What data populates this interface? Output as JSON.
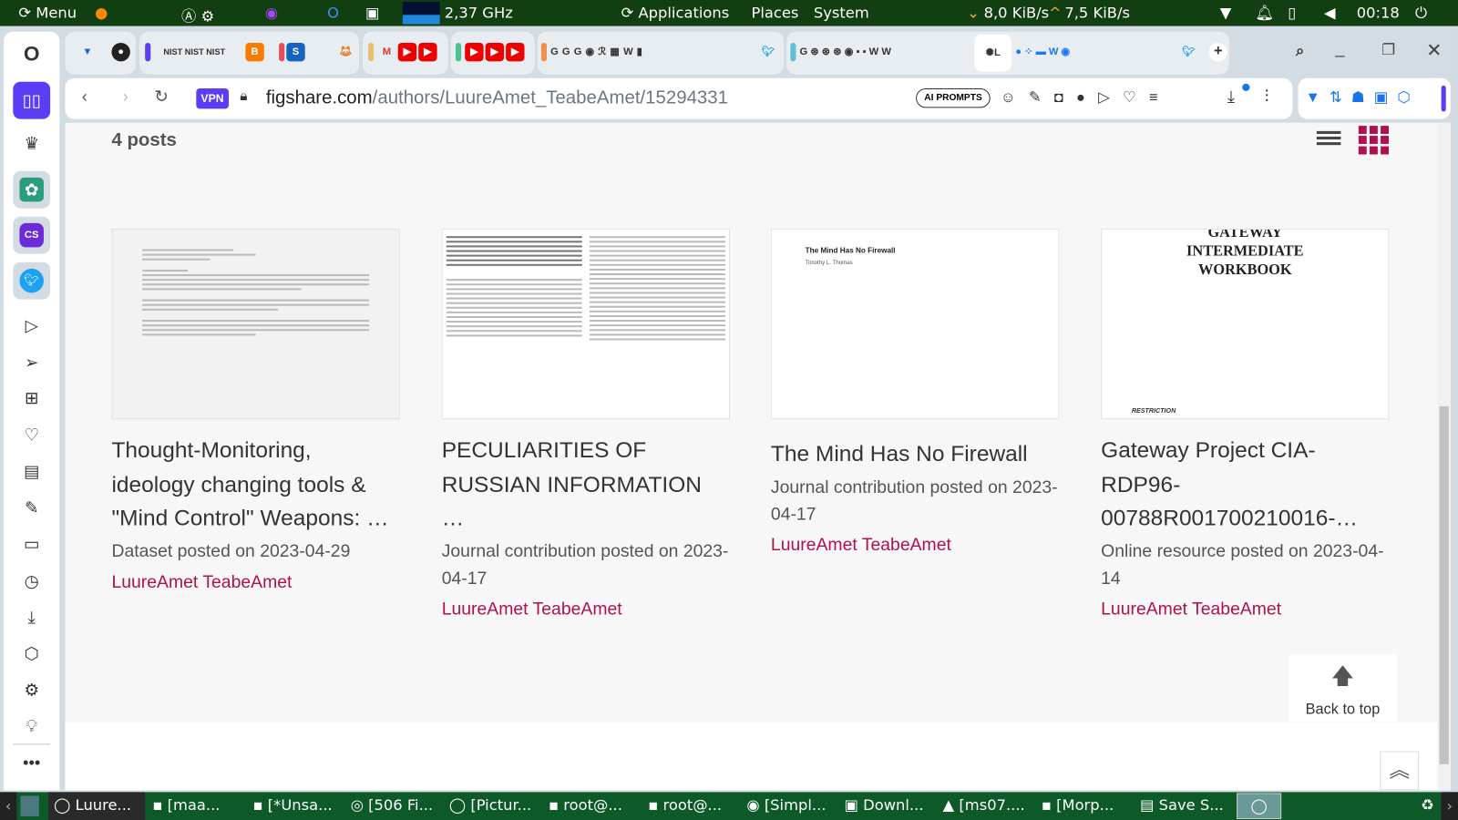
{
  "panel": {
    "menu": "Menu",
    "cpu": "2,37 GHz",
    "applications": "Applications",
    "places": "Places",
    "system": "System",
    "net_down": "8,0 KiB/s",
    "net_up": "7,5 KiB/s",
    "clock": "00:18"
  },
  "browser": {
    "url_host": "figshare.com",
    "url_path": "/authors/LuureAmet_TeabeAmet/15294331",
    "vpn": "VPN",
    "ai_prompts": "AI PROMPTS"
  },
  "page": {
    "posts_count": "4 posts",
    "back_to_top": "Back to top",
    "cards": [
      {
        "title": "Thought-Monitoring, ideology changing tools & \"Mind Control\" Weapons: …",
        "meta": "Dataset posted on 2023-04-29",
        "author": "LuureAmet TeabeAmet"
      },
      {
        "title": "PECULIARITIES OF RUSSIAN INFORMATION …",
        "meta": "Journal contribution posted on 2023-04-17",
        "author": "LuureAmet TeabeAmet"
      },
      {
        "title": "The Mind Has No Firewall",
        "meta": "Journal contribution posted on 2023-04-17",
        "author": "LuureAmet TeabeAmet",
        "thumb_title": "The Mind Has No Firewall",
        "thumb_author": "Timothy L. Thomas"
      },
      {
        "title": "Gateway Project CIA-RDP96-00788R001700210016-…",
        "meta": "Online resource posted on 2023-04-14",
        "author": "LuureAmet TeabeAmet",
        "thumb_title": "GATEWAY INTERMEDIATE WORKBOOK",
        "thumb_footer": "RESTRICTION"
      }
    ]
  },
  "taskbar": {
    "items": [
      "Luure...",
      "[maa...",
      "[*Unsa...",
      "[506 Fi...",
      "[Pictur...",
      "root@...",
      "root@...",
      "[Simpl...",
      "Downl...",
      "[ms07....",
      "[Morp...",
      "Save S..."
    ]
  },
  "colors": {
    "panel": "#123f12",
    "taskbar": "#0d5a28",
    "accent": "#b0104f",
    "sidebar_active": "#5a3df5"
  }
}
